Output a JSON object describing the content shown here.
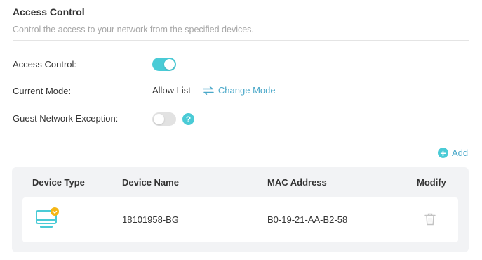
{
  "section": {
    "title": "Access Control",
    "description": "Control the access to your network from the specified devices."
  },
  "settings": {
    "access_control_label": "Access Control:",
    "access_control_enabled": true,
    "current_mode_label": "Current Mode:",
    "current_mode_value": "Allow List",
    "change_mode_label": "Change Mode",
    "guest_exception_label": "Guest Network Exception:",
    "guest_exception_enabled": false,
    "help_glyph": "?"
  },
  "toolbar": {
    "add_label": "Add"
  },
  "table": {
    "headers": {
      "device_type": "Device Type",
      "device_name": "Device Name",
      "mac_address": "MAC Address",
      "modify": "Modify"
    },
    "rows": [
      {
        "device_type_icon": "computer-icon",
        "device_name": "18101958-BG",
        "mac_address": "B0-19-21-AA-B2-58",
        "modify_icon": "trash-icon"
      }
    ]
  },
  "colors": {
    "accent": "#4acbd6",
    "link": "#4aa8c9",
    "badge": "#f5b614"
  }
}
